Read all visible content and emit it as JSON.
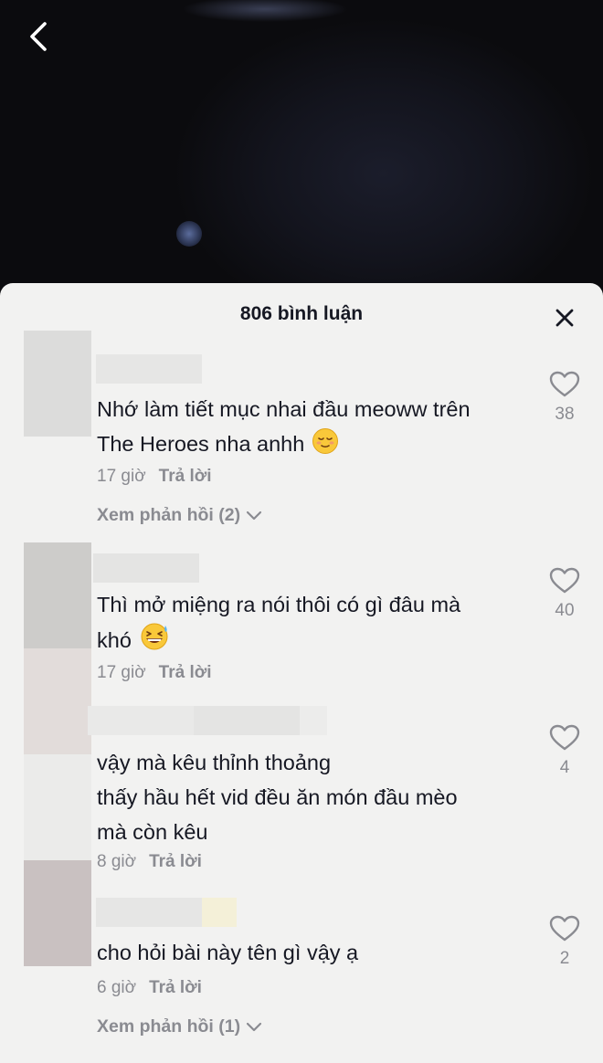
{
  "header": {
    "back_icon": "chevron-left-icon"
  },
  "sheet": {
    "title": "806 bình luận",
    "close_icon": "close-icon"
  },
  "comments": [
    {
      "text_lines": [
        "Nhớ làm tiết mục nhai đầu meoww trên",
        "The Heroes nha anhh"
      ],
      "emoji": "relieved-face",
      "time": "17 giờ",
      "reply_label": "Trả lời",
      "likes": "38",
      "view_replies": "Xem phản hồi (2)"
    },
    {
      "text_lines": [
        "Thì mở miệng ra nói thôi có gì đâu mà",
        "khó"
      ],
      "emoji": "grinning-sweat-face",
      "time": "17 giờ",
      "reply_label": "Trả lời",
      "likes": "40"
    },
    {
      "text_lines": [
        "vậy mà kêu thỉnh thoảng",
        "thấy hầu hết vid đều ăn món đầu mèo",
        "mà còn kêu"
      ],
      "time": "8 giờ",
      "reply_label": "Trả lời",
      "likes": "4"
    },
    {
      "text_lines": [
        "cho hỏi bài này tên gì vậy ạ"
      ],
      "time": "6 giờ",
      "reply_label": "Trả lời",
      "likes": "2",
      "view_replies": "Xem phản hồi (1)"
    }
  ]
}
